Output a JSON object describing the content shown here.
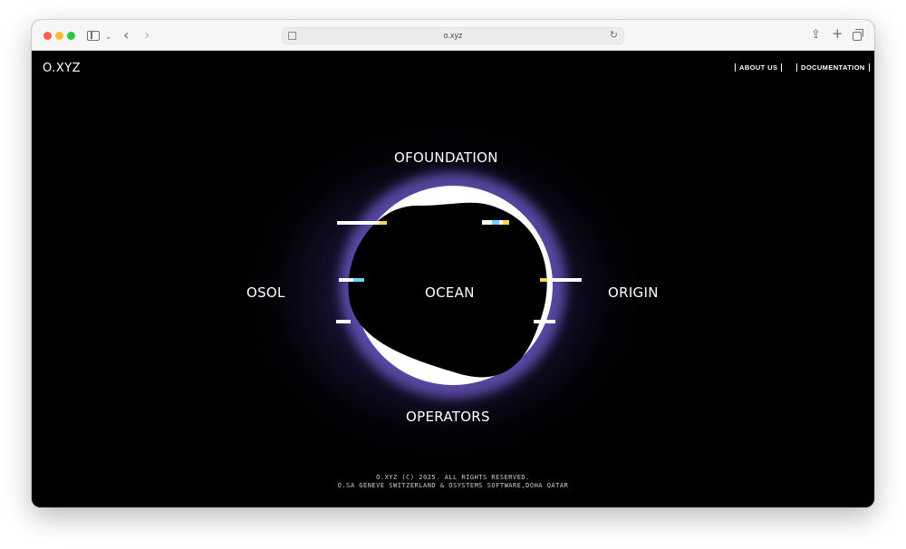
{
  "browser": {
    "url": "o.xyz",
    "icons": [
      "sidebar-icon",
      "chevron-down-icon",
      "back-arrow-icon",
      "forward-arrow-icon",
      "page-icon",
      "reload-icon",
      "share-icon",
      "plus-icon",
      "tabs-icon"
    ]
  },
  "header": {
    "logo": "O.XYZ",
    "nav": [
      "ABOUT US",
      "DOCUMENTATION"
    ]
  },
  "hero": {
    "labels": {
      "top": "OFOUNDATION",
      "left": "OSOL",
      "center": "OCEAN",
      "right": "ORIGIN",
      "bottom": "OPERATORS"
    },
    "accent_color": "#7b5cff"
  },
  "footer": {
    "line1": "O.XYZ (C) 2025. ALL RIGHTS RESERVED.",
    "line2": "O.SA GENEVE SWITZERLAND & OSYSTEMS SOFTWARE,DOHA QATAR"
  }
}
